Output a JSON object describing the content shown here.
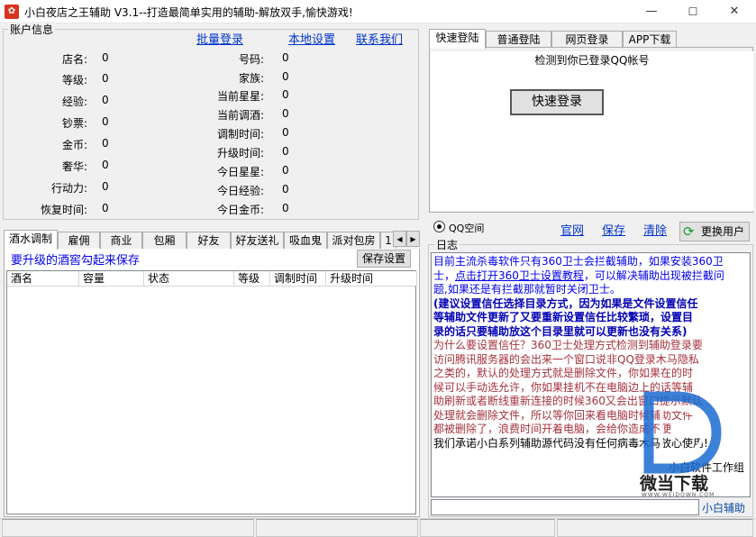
{
  "window": {
    "title": "小白夜店之王辅助 V3.1--打造最简单实用的辅助-解放双手,愉快游戏!",
    "minimize": "—",
    "maximize": "☐",
    "close": "✕"
  },
  "account": {
    "legend": "账户信息",
    "links": [
      "批量登录",
      "本地设置",
      "联系我们"
    ],
    "left_fields": [
      {
        "label": "店名:",
        "value": "0"
      },
      {
        "label": "等级:",
        "value": "0"
      },
      {
        "label": "经验:",
        "value": "0"
      },
      {
        "label": "钞票:",
        "value": "0"
      },
      {
        "label": "金币:",
        "value": "0"
      },
      {
        "label": "奢华:",
        "value": "0"
      },
      {
        "label": "行动力:",
        "value": "0"
      },
      {
        "label": "恢复时间:",
        "value": "0"
      }
    ],
    "right_fields": [
      {
        "label": "号码:",
        "value": "0"
      },
      {
        "label": "家族:",
        "value": "0"
      },
      {
        "label": "当前星星:",
        "value": "0"
      },
      {
        "label": "当前调酒:",
        "value": "0"
      },
      {
        "label": "调制时间:",
        "value": "0"
      },
      {
        "label": "升级时间:",
        "value": "0"
      },
      {
        "label": "今日星星:",
        "value": "0"
      },
      {
        "label": "今日经验:",
        "value": "0"
      },
      {
        "label": "今日金币:",
        "value": "0"
      }
    ]
  },
  "func_tabs": [
    "酒水调制",
    "雇佣",
    "商业",
    "包厢",
    "好友",
    "好友送礼",
    "吸血鬼",
    "派对包房",
    "1"
  ],
  "tab_scroll": {
    "left": "◀",
    "right": "▶"
  },
  "brew": {
    "hint": "要升级的酒窖勾起来保存",
    "save_button": "保存设置",
    "columns": [
      "酒名",
      "容量",
      "状态",
      "等级",
      "调制时间",
      "升级时间"
    ]
  },
  "login_tabs": [
    "快速登陆",
    "普通登陆",
    "网页登录",
    "APP下载"
  ],
  "login": {
    "detected": "检测到你已登录QQ帐号",
    "quick_button": "快速登录"
  },
  "midbar": {
    "radio_label": "QQ空间",
    "links": [
      "官网",
      "保存",
      "清除"
    ],
    "switch_user": "更换用户"
  },
  "log": {
    "legend": "日志",
    "line1": "目前主流杀毒软件只有360卫士会拦截辅助，如果安装360卫",
    "line2_pre": "士，",
    "line2_link": "点击打开360卫士设置教程",
    "line2_post": "，可以解决辅助出现被拦截问",
    "line3": "题,如果还是有拦截那就暂时关闭卫士。",
    "bold_lines": [
      "(建议设置信任选择目录方式，因为如果是文件设置信任",
      "等辅助文件更新了又要重新设置信任比较繁琐，设置目",
      "录的话只要辅助放这个目录里就可以更新也没有关系)"
    ],
    "reason_lines": [
      "为什么要设置信任？360卫士处理方式检测到辅助登录要",
      "访问腾讯服务器的会出来一个窗口说非QQ登录木马隐私",
      "之类的，默认的处理方式就是删除文件，你如果在的时",
      "候可以手动选允许，你如果挂机不在电脑边上的话等辅",
      "助刷新或者断线重新连接的时候360又会出窗口提示默认",
      "处理就会删除文件，所以等你回来看电脑时候辅助文件",
      "都被删除了，浪费时间开着电脑，会给你造成不便"
    ],
    "promise": "我们承诺小白系列辅助源代码没有任何病毒木马放心使用!",
    "signature": "小白软件工作组",
    "footer": "小白辅助"
  },
  "watermark": {
    "brand": "微当下载",
    "url": "WWW.WEIDOWN.COM"
  },
  "colors": {
    "blue_text": "#0000ee",
    "bold_blue": "#0000b4",
    "reason_red": "#a5323c",
    "accent": "#0a4aa8"
  }
}
